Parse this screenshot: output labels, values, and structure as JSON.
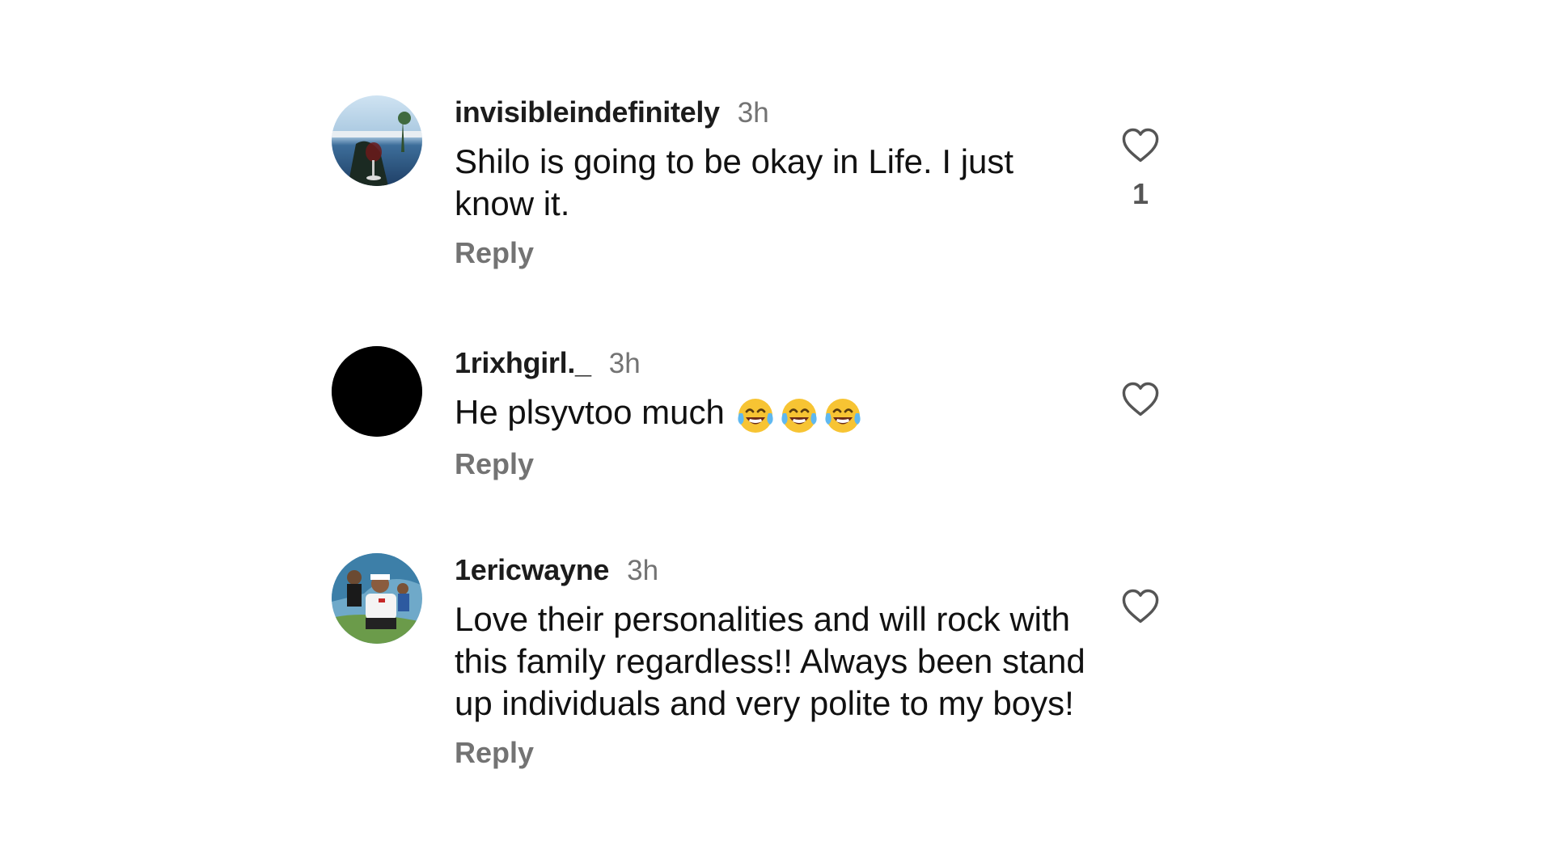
{
  "comments": [
    {
      "username": "invisibleindefinitely",
      "time": "3h",
      "text": "Shilo is going to be okay in Life. I just know it.",
      "reply_label": "Reply",
      "like_count": "1",
      "avatar_icon": "photo-avatar-drink-by-sea"
    },
    {
      "username": "1rixhgirl._",
      "time": "3h",
      "text": "He plsyvtoo much",
      "emoji": [
        "face-with-tears-of-joy",
        "face-with-tears-of-joy",
        "face-with-tears-of-joy"
      ],
      "reply_label": "Reply",
      "avatar_icon": "black-circle-avatar"
    },
    {
      "username": "1ericwayne",
      "time": "3h",
      "text": "Love their personalities and will rock with this family regardless!! Always been stand up individuals and very polite to my boys!",
      "reply_label": "Reply",
      "avatar_icon": "photo-avatar-family"
    }
  ],
  "colors": {
    "text": "#111111",
    "secondary": "#737373",
    "heart_outline": "#555555",
    "background": "#ffffff"
  }
}
